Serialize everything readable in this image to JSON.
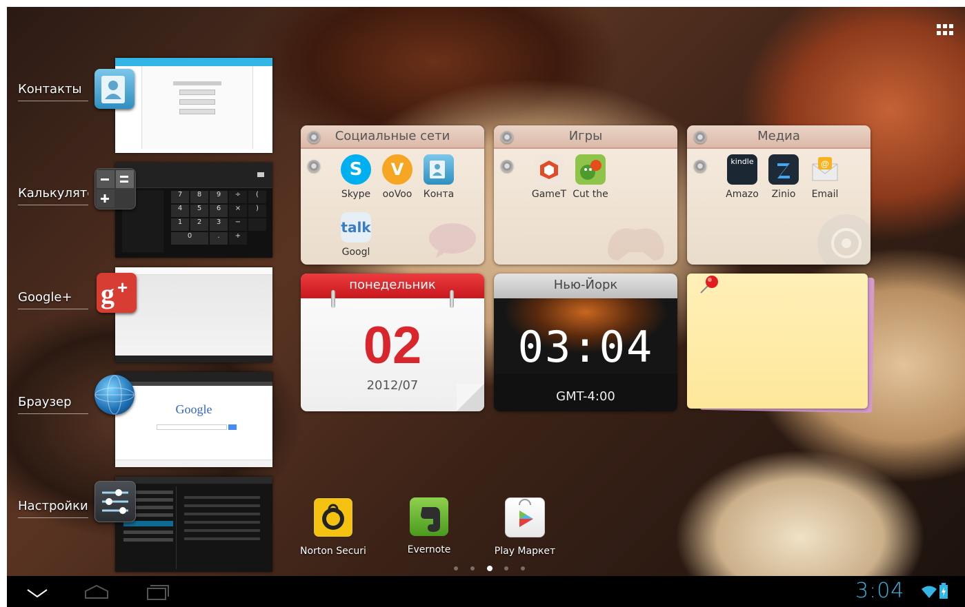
{
  "recent_apps": [
    {
      "label": "Контакты",
      "icon": "contacts-icon"
    },
    {
      "label": "Калькулятор",
      "icon": "calculator-icon"
    },
    {
      "label": "Google+",
      "icon": "google-plus-icon"
    },
    {
      "label": "Браузер",
      "icon": "browser-globe-icon"
    },
    {
      "label": "Настройки",
      "icon": "settings-sliders-icon"
    }
  ],
  "calculator": {
    "keys": [
      "7",
      "8",
      "9",
      "÷",
      "(",
      "4",
      "5",
      "6",
      "×",
      ")",
      "1",
      "2",
      "3",
      "−",
      "0",
      ".",
      "+"
    ]
  },
  "browser_thumb": {
    "logo_text": "Google"
  },
  "folders": [
    {
      "title": "Социальные сети",
      "apps": [
        {
          "label": "Skype",
          "icon": "skype-icon"
        },
        {
          "label": "ooVoo",
          "icon": "oovoo-icon"
        },
        {
          "label": "Конта",
          "icon": "contacts-icon"
        },
        {
          "label": "Googl",
          "icon": "google-talk-icon"
        }
      ]
    },
    {
      "title": "Игры",
      "apps": [
        {
          "label": "GameT",
          "icon": "gametime-icon"
        },
        {
          "label": "Cut the",
          "icon": "cut-the-rope-icon"
        }
      ]
    },
    {
      "title": "Медиа",
      "apps": [
        {
          "label": "Amazo",
          "icon": "kindle-icon"
        },
        {
          "label": "Zinio",
          "icon": "zinio-icon"
        },
        {
          "label": "Email",
          "icon": "email-icon"
        }
      ]
    }
  ],
  "calendar": {
    "day": "понедельник",
    "date": "02",
    "month": "2012/07"
  },
  "clock_widget": {
    "city": "Нью-Йорк",
    "time": "03:04",
    "timezone": "GMT-4:00"
  },
  "dock": [
    {
      "label": "Norton Securi",
      "icon": "norton-lock-icon"
    },
    {
      "label": "Evernote",
      "icon": "evernote-icon"
    },
    {
      "label": "Play Маркет",
      "icon": "play-store-icon"
    }
  ],
  "labels": {
    "talk": "talk",
    "kindle": "kindle"
  },
  "page_indicator": {
    "count": 5,
    "active": 3
  },
  "status_bar": {
    "time": "3:04"
  },
  "colors": {
    "accent": "#33b5e5",
    "calendar_red": "#d9262c",
    "navbar": "#000000"
  }
}
